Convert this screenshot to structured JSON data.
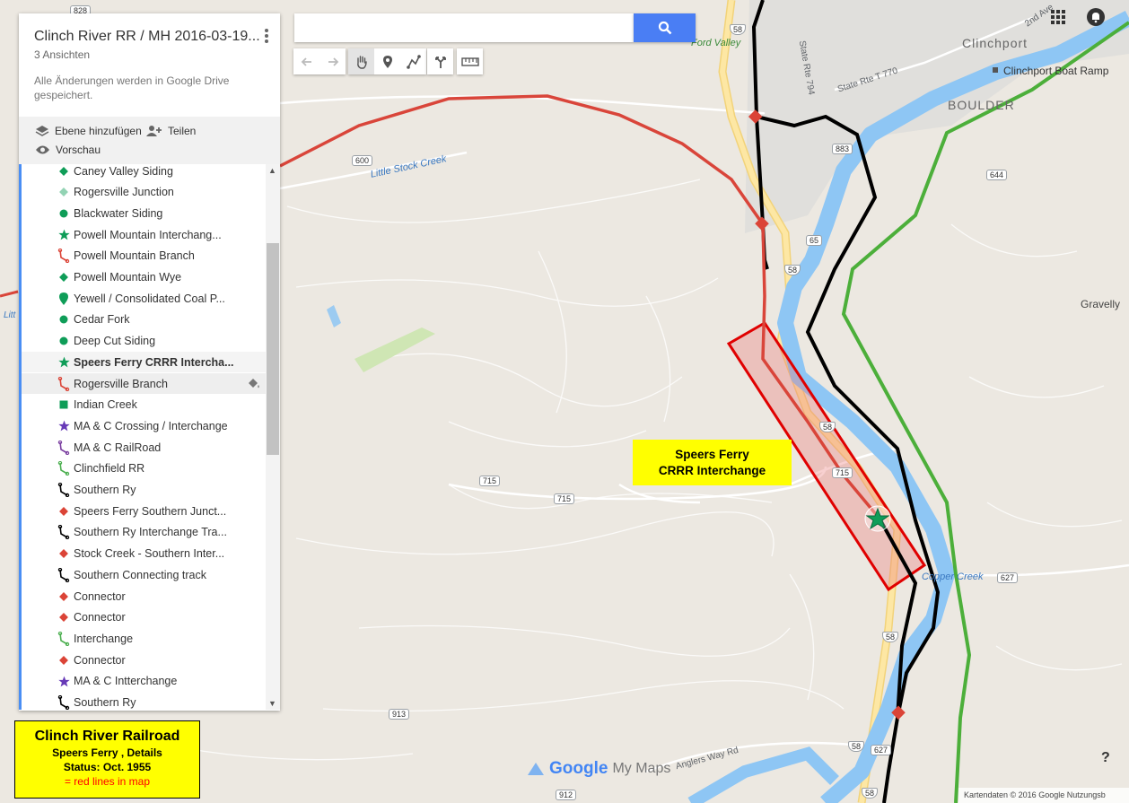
{
  "panel": {
    "title": "Clinch River RR / MH 2016-03-19...",
    "views": "3 Ansichten",
    "saved": "Alle Änderungen werden in Google Drive gespeichert.",
    "add_layer": "Ebene hinzufügen",
    "share": "Teilen",
    "preview": "Vorschau"
  },
  "layers": [
    {
      "label": "Caney Valley Siding",
      "icon": "diamond",
      "color": "#0f9d58"
    },
    {
      "label": "Rogersville Junction",
      "icon": "diamond",
      "color": "#93d3b4"
    },
    {
      "label": "Blackwater Siding",
      "icon": "circle",
      "color": "#0f9d58"
    },
    {
      "label": "Powell Mountain Interchang...",
      "icon": "star",
      "color": "#0f9d58"
    },
    {
      "label": "Powell Mountain Branch",
      "icon": "line",
      "color": "#db4437"
    },
    {
      "label": "Powell Mountain Wye",
      "icon": "diamond",
      "color": "#0f9d58"
    },
    {
      "label": "Yewell / Consolidated Coal P...",
      "icon": "pin",
      "color": "#0f9d58"
    },
    {
      "label": "Cedar Fork",
      "icon": "circle",
      "color": "#0f9d58"
    },
    {
      "label": "Deep Cut Siding",
      "icon": "circle",
      "color": "#0f9d58"
    },
    {
      "label": "Speers Ferry CRRR Intercha...",
      "icon": "star",
      "color": "#0f9d58"
    },
    {
      "label": "Rogersville Branch",
      "icon": "line",
      "color": "#db4437"
    },
    {
      "label": "Indian Creek",
      "icon": "square",
      "color": "#0f9d58"
    },
    {
      "label": "MA & C Crossing / Interchange",
      "icon": "star",
      "color": "#673ab7"
    },
    {
      "label": "MA & C RailRoad",
      "icon": "line",
      "color": "#7b3fa0"
    },
    {
      "label": "Clinchfield RR",
      "icon": "line",
      "color": "#4caf50"
    },
    {
      "label": "Southern Ry",
      "icon": "line",
      "color": "#000000"
    },
    {
      "label": "Speers Ferry Southern Junct...",
      "icon": "diamond",
      "color": "#db4437"
    },
    {
      "label": "Southern Ry Interchange Tra...",
      "icon": "line",
      "color": "#000000"
    },
    {
      "label": "Stock Creek - Southern Inter...",
      "icon": "diamond",
      "color": "#db4437"
    },
    {
      "label": "Southern Connecting track",
      "icon": "line",
      "color": "#000000"
    },
    {
      "label": "Connector",
      "icon": "diamond",
      "color": "#db4437"
    },
    {
      "label": "Connector",
      "icon": "diamond",
      "color": "#db4437"
    },
    {
      "label": "Interchange",
      "icon": "line",
      "color": "#4caf50"
    },
    {
      "label": "Connector",
      "icon": "diamond",
      "color": "#db4437"
    },
    {
      "label": "MA & C Intterchange",
      "icon": "star",
      "color": "#673ab7"
    },
    {
      "label": "Southern Ry",
      "icon": "line",
      "color": "#000000"
    }
  ],
  "search": {
    "placeholder": "",
    "value": ""
  },
  "map_labels": {
    "clinchport": "Clinchport",
    "clinchport_boat": "Clinchport Boat Ramp",
    "boulder": "BOULDER",
    "ford_valley": "Ford Valley",
    "state_rte_794": "State Rte 794",
    "state_rte_770": "State Rte T 770",
    "little_stock_creek": "Little Stock Creek",
    "gravelly": "Gravelly",
    "copper_creek": "Copper Creek",
    "anglers_way": "Anglers Way Rd",
    "second_ave": "2nd Ave",
    "litt": "Litt"
  },
  "highways": {
    "h828": "828",
    "h58a": "58",
    "h600": "600",
    "h883": "883",
    "h644": "644",
    "h65": "65",
    "h58b": "58",
    "h58c": "58",
    "h715a": "715",
    "h715b": "715",
    "h715c": "715",
    "h627a": "627",
    "h58d": "58",
    "h58e": "58",
    "h627b": "627",
    "h913": "913",
    "h912": "912",
    "h58f": "58"
  },
  "callout": {
    "line1": "Speers Ferry",
    "line2": "CRRR Interchange"
  },
  "legend": {
    "title": "Clinch River Railroad",
    "line2": "Speers Ferry , Details",
    "line3": "Status: Oct. 1955",
    "line4": "= red lines in map"
  },
  "footer": {
    "google": "Google",
    "mymaps": "My Maps",
    "copyright": "Kartendaten © 2016 Google    Nutzungsb",
    "help": "?"
  },
  "colors": {
    "red_line": "#d9453a",
    "black_line": "#000000",
    "green_line": "#4caf3a",
    "river": "#8ec6f4",
    "road": "#fde293",
    "accent": "#4a7ef4"
  }
}
